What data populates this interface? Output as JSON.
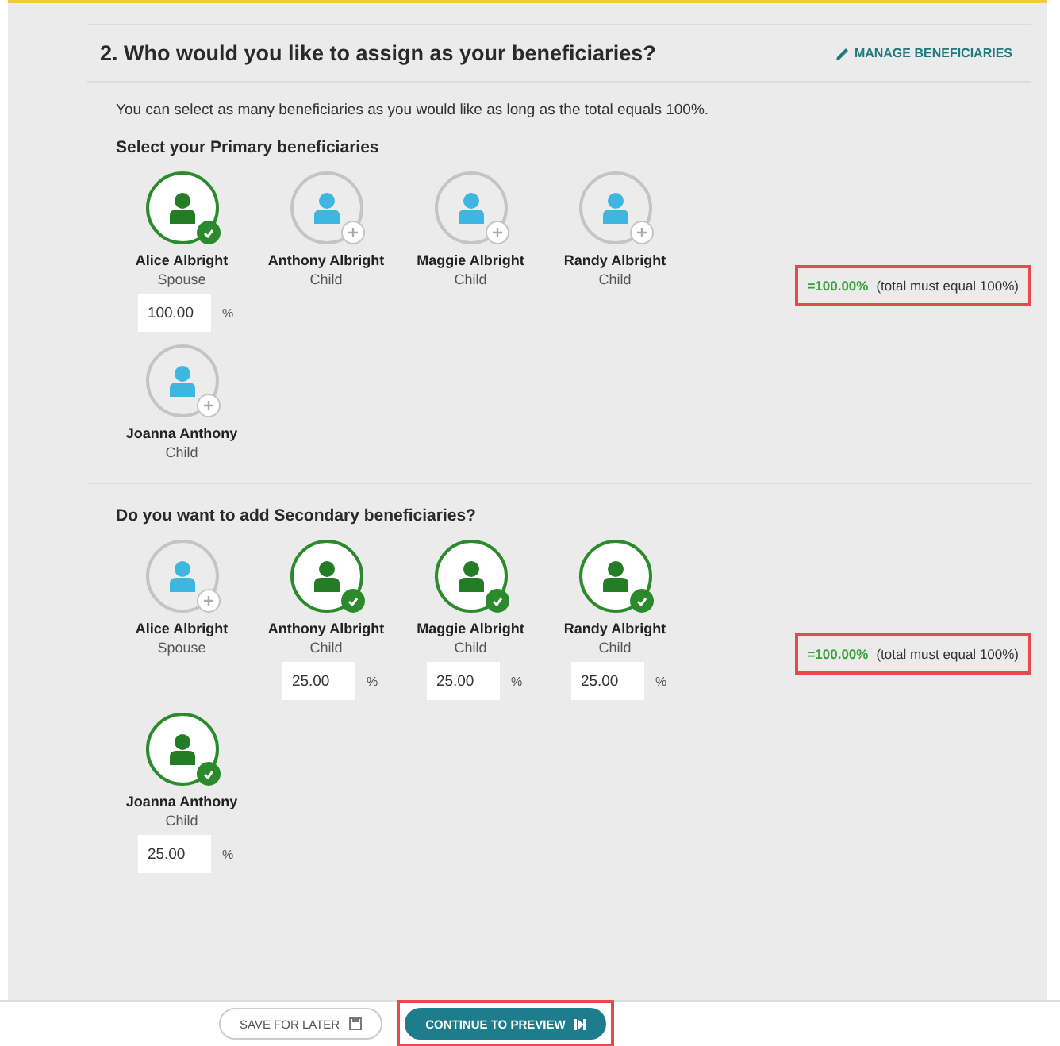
{
  "header": {
    "title": "2. Who would you like to assign as your beneficiaries?",
    "action": "MANAGE BENEFICIARIES"
  },
  "intro": "You can select as many beneficiaries as you would like as long as the total equals 100%.",
  "sections": [
    {
      "title": "Select your Primary beneficiaries",
      "people": [
        {
          "name": "Alice Albright",
          "relation": "Spouse",
          "selected": true,
          "percent": "100.00",
          "unit": "%"
        },
        {
          "name": "Anthony Albright",
          "relation": "Child",
          "selected": false
        },
        {
          "name": "Maggie Albright",
          "relation": "Child",
          "selected": false
        },
        {
          "name": "Randy Albright",
          "relation": "Child",
          "selected": false
        },
        {
          "name": "Joanna Anthony",
          "relation": "Child",
          "selected": false
        }
      ],
      "total": {
        "value": "=100.00%",
        "note": "(total must equal 100%)",
        "highlighted": true
      }
    },
    {
      "title": "Do you want to add Secondary beneficiaries?",
      "people": [
        {
          "name": "Alice Albright",
          "relation": "Spouse",
          "selected": false
        },
        {
          "name": "Anthony Albright",
          "relation": "Child",
          "selected": true,
          "percent": "25.00",
          "unit": "%"
        },
        {
          "name": "Maggie Albright",
          "relation": "Child",
          "selected": true,
          "percent": "25.00",
          "unit": "%"
        },
        {
          "name": "Randy Albright",
          "relation": "Child",
          "selected": true,
          "percent": "25.00",
          "unit": "%"
        },
        {
          "name": "Joanna Anthony",
          "relation": "Child",
          "selected": true,
          "percent": "25.00",
          "unit": "%"
        }
      ],
      "total": {
        "value": "=100.00%",
        "note": "(total must equal 100%)",
        "highlighted": true
      }
    }
  ],
  "footer": {
    "buttons": [
      {
        "label": "SAVE FOR LATER",
        "kind": "secondary",
        "highlighted": false
      },
      {
        "label": "CONTINUE TO PREVIEW",
        "kind": "primary",
        "highlighted": true
      }
    ]
  }
}
